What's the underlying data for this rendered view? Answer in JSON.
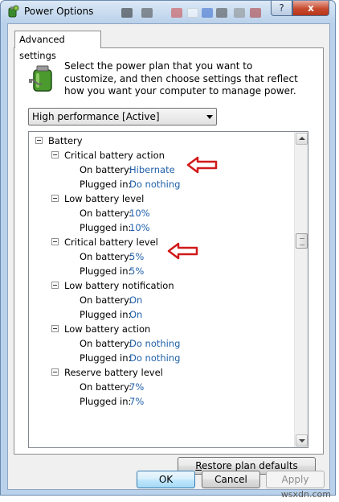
{
  "window": {
    "title": "Power Options",
    "help_label": "?",
    "close_label": "x"
  },
  "tab": {
    "label": "Advanced settings"
  },
  "intro_text": "Select the power plan that you want to customize, and then choose settings that reflect how you want your computer to manage power.",
  "plan_select": {
    "value": "High performance [Active]"
  },
  "tree": {
    "root": "Battery",
    "groups": [
      {
        "label": "Critical battery action",
        "on_battery_label": "On battery:",
        "on_battery": "Hibernate",
        "plugged_in_label": "Plugged in:",
        "plugged_in": "Do nothing"
      },
      {
        "label": "Low battery level",
        "on_battery_label": "On battery:",
        "on_battery": "10%",
        "plugged_in_label": "Plugged in:",
        "plugged_in": "10%"
      },
      {
        "label": "Critical battery level",
        "on_battery_label": "On battery:",
        "on_battery": "5%",
        "plugged_in_label": "Plugged in:",
        "plugged_in": "5%"
      },
      {
        "label": "Low battery notification",
        "on_battery_label": "On battery:",
        "on_battery": "On",
        "plugged_in_label": "Plugged in:",
        "plugged_in": "On"
      },
      {
        "label": "Low battery action",
        "on_battery_label": "On battery:",
        "on_battery": "Do nothing",
        "plugged_in_label": "Plugged in:",
        "plugged_in": "Do nothing"
      },
      {
        "label": "Reserve battery level",
        "on_battery_label": "On battery:",
        "on_battery": "7%",
        "plugged_in_label": "Plugged in:",
        "plugged_in": "7%"
      }
    ]
  },
  "buttons": {
    "restore_first": "R",
    "restore_rest": "estore plan defaults",
    "ok": "OK",
    "cancel": "Cancel",
    "apply": "Apply"
  },
  "colors": {
    "setting_value": "#1f5fa8",
    "annotation_arrow": "#d11a1a",
    "title_bar": "#b9d1ea"
  },
  "watermark": "wsxdn.com"
}
